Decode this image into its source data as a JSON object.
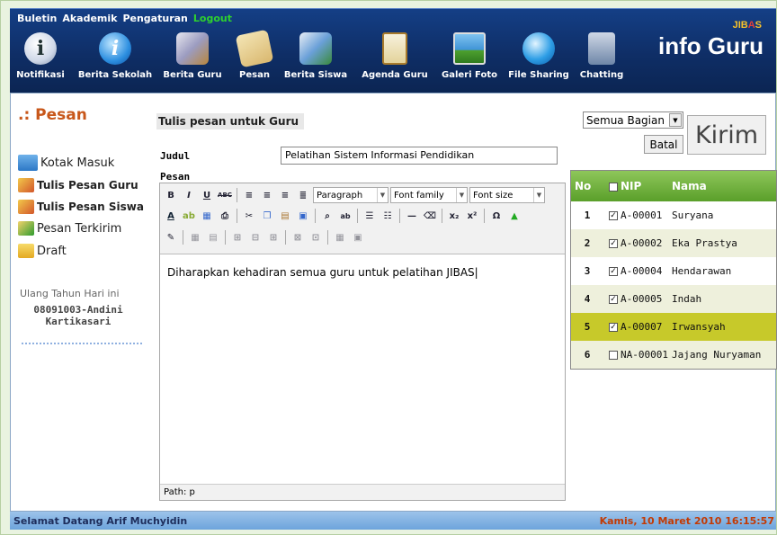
{
  "topmenu": {
    "buletin": "Buletin",
    "akademik": "Akademik",
    "pengaturan": "Pengaturan",
    "logout": "Logout"
  },
  "toolbar": [
    {
      "label": "Notifikasi",
      "icon": "info-icon"
    },
    {
      "label": "Berita Sekolah",
      "icon": "info-circle-icon"
    },
    {
      "label": "Berita Guru",
      "icon": "teacher-icon"
    },
    {
      "label": "Pesan",
      "icon": "envelope-icon"
    },
    {
      "label": "Berita Siswa",
      "icon": "student-icon"
    },
    {
      "label": "Agenda Guru",
      "icon": "clipboard-icon"
    },
    {
      "label": "Galeri Foto",
      "icon": "photo-icon"
    },
    {
      "label": "File Sharing",
      "icon": "globe-icon"
    },
    {
      "label": "Chatting",
      "icon": "chat-icon"
    }
  ],
  "logo": {
    "sub_a": "JIB",
    "sub_b": "A",
    "sub_c": "S",
    "main": "info Guru"
  },
  "leftnav": {
    "title": ".: Pesan",
    "items": [
      "Kotak Masuk",
      "Tulis Pesan Guru",
      "Tulis Pesan Siswa",
      "Pesan Terkirim",
      "Draft"
    ],
    "birthday_label": "Ulang Tahun Hari ini",
    "birthday_name": "08091003-Andini Kartikasari"
  },
  "form": {
    "title": "Tulis pesan untuk Guru",
    "judul_label": "Judul",
    "judul_value": "Pelatihan Sistem Informasi Pendidikan",
    "pesan_label": "Pesan",
    "format_select": "Paragraph",
    "font_family": "Font family",
    "font_size": "Font size",
    "body": "Diharapkan kehadiran semua guru untuk pelatihan JIBAS",
    "path": "Path: p"
  },
  "actions": {
    "bagian": "Semua Bagian",
    "batal": "Batal",
    "kirim": "Kirim"
  },
  "recipients": {
    "headers": [
      "No",
      "NIP",
      "Nama"
    ],
    "rows": [
      {
        "no": "1",
        "nip": "A-00001",
        "nama": "Suryana",
        "checked": true
      },
      {
        "no": "2",
        "nip": "A-00002",
        "nama": "Eka Prastya",
        "checked": true
      },
      {
        "no": "3",
        "nip": "A-00004",
        "nama": "Hendarawan",
        "checked": true
      },
      {
        "no": "4",
        "nip": "A-00005",
        "nama": "Indah",
        "checked": true
      },
      {
        "no": "5",
        "nip": "A-00007",
        "nama": "Irwansyah",
        "checked": true
      },
      {
        "no": "6",
        "nip": "NA-00001",
        "nama": "Jajang Nuryaman",
        "checked": false
      }
    ]
  },
  "footer": {
    "welcome": "Selamat Datang Arif Muchyidin",
    "datetime": "Kamis, 10 Maret 2010 16:15:57"
  }
}
